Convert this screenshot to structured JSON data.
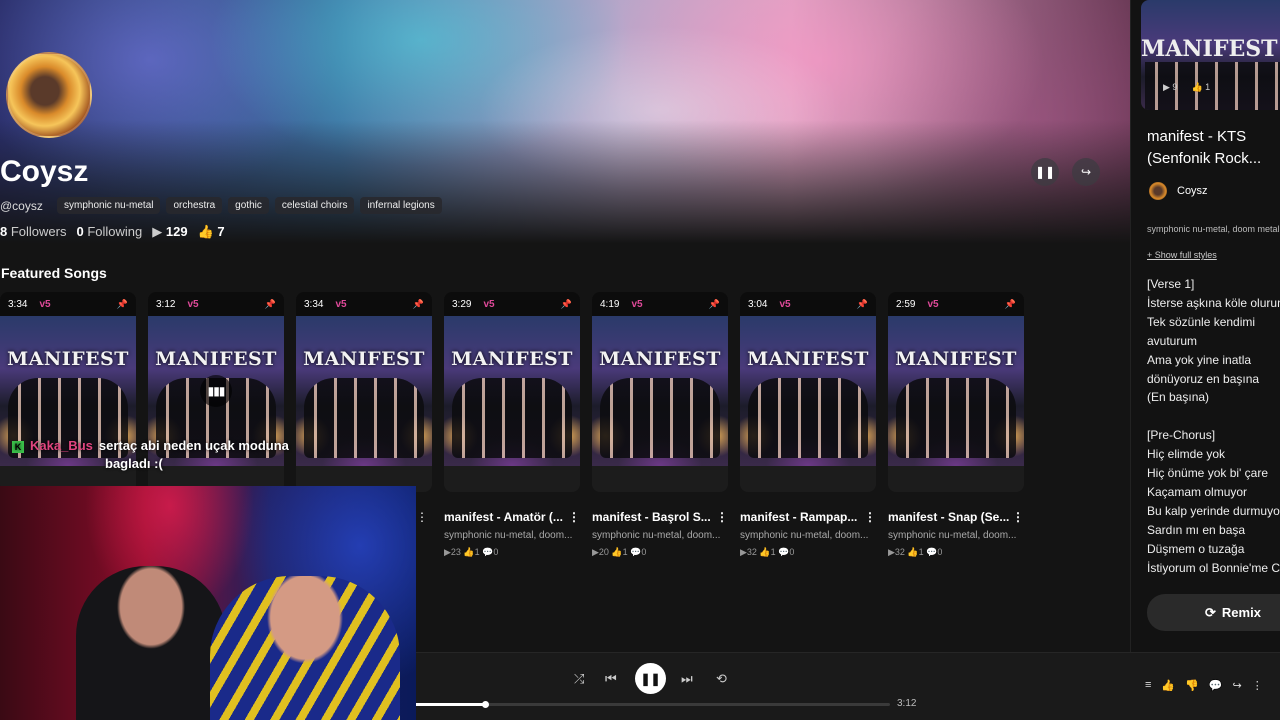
{
  "profile": {
    "name": "Coysz",
    "handle": "@coysz",
    "tags": [
      "symphonic nu-metal",
      "orchestra",
      "gothic",
      "celestial choirs",
      "infernal legions"
    ],
    "followers_count": "8",
    "followers_label": "Followers",
    "following_count": "0",
    "following_label": "Following",
    "plays": "129",
    "likes": "7"
  },
  "featured": {
    "title": "Featured Songs",
    "cards": [
      {
        "duration": "3:34",
        "version": "v5"
      },
      {
        "duration": "3:12",
        "version": "v5"
      },
      {
        "duration": "3:34",
        "version": "v5"
      },
      {
        "duration": "3:29",
        "version": "v5"
      },
      {
        "duration": "4:19",
        "version": "v5"
      },
      {
        "duration": "3:04",
        "version": "v5"
      },
      {
        "duration": "2:59",
        "version": "v5"
      }
    ],
    "cover_text": "MANIFEST",
    "songs": [
      {
        "title": "manifest - Amatör (...",
        "genre": "symphonic nu-metal, doom...",
        "stats": "▶23 👍1 💬0"
      },
      {
        "title": "manifest - Başrol S...",
        "genre": "symphonic nu-metal, doom...",
        "stats": "▶20 👍1 💬0"
      },
      {
        "title": "manifest - Rampap...",
        "genre": "symphonic nu-metal, doom...",
        "stats": "▶32 👍1 💬0"
      },
      {
        "title": "manifest - Snap (Se...",
        "genre": "symphonic nu-metal, doom...",
        "stats": "▶32 👍1 💬0"
      }
    ]
  },
  "chat": {
    "badge": "K",
    "user": "Kaka_Bus",
    "line1": "sertaç abi neden uçak moduna",
    "line2": "bagladı :("
  },
  "now_playing": {
    "cover_text": "MANIFEST",
    "cover_plays": "▶ 9",
    "cover_likes": "👍 1",
    "title_line1": "manifest - KTS",
    "title_line2": "(Senfonik Rock...",
    "artist": "Coysz",
    "genre": "symphonic nu-metal, doom metal",
    "show_styles": "+ Show full styles",
    "lyrics": [
      "[Verse 1]",
      "İsterse aşkına köle olurum",
      "Tek sözünle kendimi",
      "avuturum",
      "Ama yok yine inatla",
      "dönüyoruz en başına",
      "(En başına)",
      "",
      "[Pre-Chorus]",
      "Hiç elimde yok",
      "Hiç önüme yok bi' çare",
      "Kaçamam olmuyor",
      "Bu kalp yerinde durmuyor",
      "Sardın mı en başa",
      "Düşmem o tuzağa",
      "İstiyorum ol Bonnie'me Cl"
    ],
    "remix_label": "Remix"
  },
  "player": {
    "duration": "3:12",
    "progress": 0.145
  },
  "icons": {
    "pause": "❚❚",
    "share": "↪",
    "shuffle": "⤮",
    "prev": "⏮",
    "next": "⏭",
    "repeat": "⟲",
    "more": "⋮",
    "pin": "📌"
  },
  "colors": {
    "accent_version": "#e04a9a",
    "chat_user": "#e0457f"
  }
}
